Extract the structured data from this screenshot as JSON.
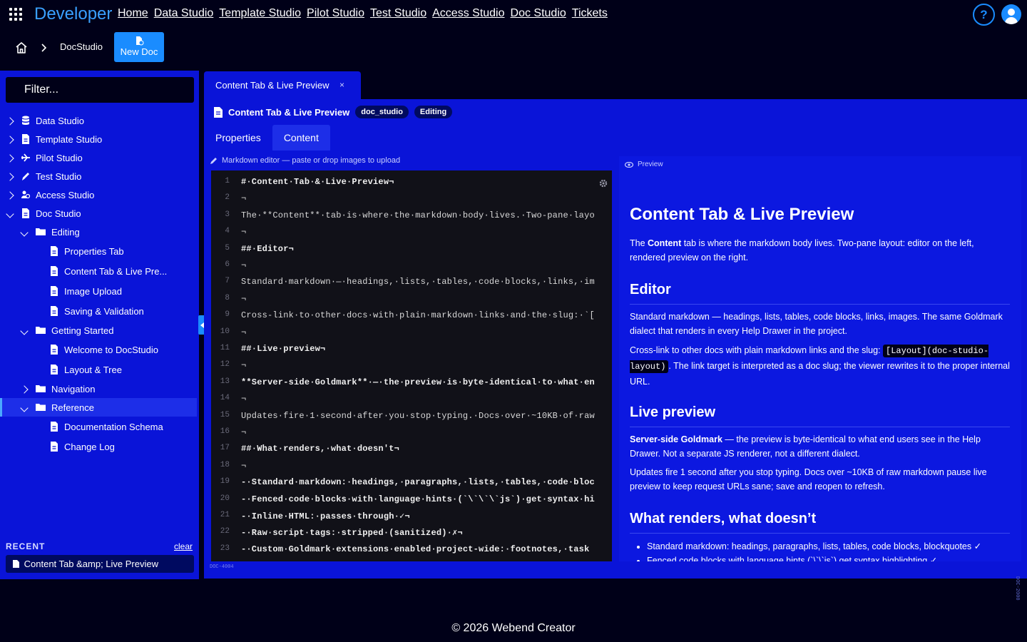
{
  "app": {
    "brand": "Developer",
    "nav": [
      "Home",
      "Data Studio",
      "Template Studio",
      "Pilot Studio",
      "Test Studio",
      "Access Studio",
      "Doc Studio",
      "Tickets"
    ],
    "help_label": "?"
  },
  "breadcrumb": {
    "current": "DocStudio",
    "new_doc_label": "New Doc"
  },
  "sidebar": {
    "filter_placeholder": "Filter...",
    "tree": [
      {
        "label": "Data Studio",
        "icon": "database-icon",
        "level": 0,
        "chevron": "right"
      },
      {
        "label": "Template Studio",
        "icon": "document-icon",
        "level": 0,
        "chevron": "right"
      },
      {
        "label": "Pilot Studio",
        "icon": "plane-icon",
        "level": 0,
        "chevron": "right"
      },
      {
        "label": "Test Studio",
        "icon": "pencil-icon",
        "level": 0,
        "chevron": "right"
      },
      {
        "label": "Access Studio",
        "icon": "users-icon",
        "level": 0,
        "chevron": "right"
      },
      {
        "label": "Doc Studio",
        "icon": "document-icon",
        "level": 0,
        "chevron": "down"
      },
      {
        "label": "Editing",
        "icon": "folder-icon",
        "level": 1,
        "chevron": "down"
      },
      {
        "label": "Properties Tab",
        "icon": "document-icon",
        "level": 2,
        "chevron": ""
      },
      {
        "label": "Content Tab & Live Pre...",
        "icon": "document-icon",
        "level": 2,
        "chevron": ""
      },
      {
        "label": "Image Upload",
        "icon": "document-icon",
        "level": 2,
        "chevron": ""
      },
      {
        "label": "Saving & Validation",
        "icon": "document-icon",
        "level": 2,
        "chevron": ""
      },
      {
        "label": "Getting Started",
        "icon": "folder-icon",
        "level": 1,
        "chevron": "down"
      },
      {
        "label": "Welcome to DocStudio",
        "icon": "document-icon",
        "level": 2,
        "chevron": ""
      },
      {
        "label": "Layout & Tree",
        "icon": "document-icon",
        "level": 2,
        "chevron": ""
      },
      {
        "label": "Navigation",
        "icon": "folder-icon",
        "level": 1,
        "chevron": "right"
      },
      {
        "label": "Reference",
        "icon": "folder-icon",
        "level": 1,
        "chevron": "down",
        "selected": true
      },
      {
        "label": "Documentation Schema",
        "icon": "document-icon",
        "level": 2,
        "chevron": ""
      },
      {
        "label": "Change Log",
        "icon": "document-icon",
        "level": 2,
        "chevron": ""
      }
    ],
    "recent_title": "RECENT",
    "recent_clear": "clear",
    "recent_item": "Content Tab &amp; Live Preview"
  },
  "doc": {
    "tab_title": "Content Tab & Live Preview",
    "close": "×",
    "title": "Content Tab & Live Preview",
    "pills": [
      "doc_studio",
      "Editing"
    ],
    "subtabs": [
      "Properties",
      "Content"
    ],
    "active_subtab": "Content",
    "editor_label": "Markdown editor — paste or drop images to upload",
    "editor_id": "DOC-4004",
    "side_id": "DOC-2000",
    "preview_label": "Preview"
  },
  "editor_lines": [
    {
      "n": "1",
      "t": "#·Content·Tab·&·Live·Preview¬",
      "h": true
    },
    {
      "n": "2",
      "t": "¬"
    },
    {
      "n": "3",
      "t": "The·**Content**·tab·is·where·the·markdown·body·lives.·Two-pane·layo"
    },
    {
      "n": "4",
      "t": "¬"
    },
    {
      "n": "5",
      "t": "##·Editor¬",
      "h": true
    },
    {
      "n": "6",
      "t": "¬"
    },
    {
      "n": "7",
      "t": "Standard·markdown·—·headings,·lists,·tables,·code·blocks,·links,·im"
    },
    {
      "n": "8",
      "t": "¬"
    },
    {
      "n": "9",
      "t": "Cross-link·to·other·docs·with·plain·markdown·links·and·the·slug:·`["
    },
    {
      "n": "10",
      "t": "¬"
    },
    {
      "n": "11",
      "t": "##·Live·preview¬",
      "h": true
    },
    {
      "n": "12",
      "t": "¬"
    },
    {
      "n": "13",
      "t": "**Server-side·Goldmark**·—·the·preview·is·byte-identical·to·what·en",
      "h": true
    },
    {
      "n": "14",
      "t": "¬"
    },
    {
      "n": "15",
      "t": "Updates·fire·1·second·after·you·stop·typing.·Docs·over·~10KB·of·raw"
    },
    {
      "n": "16",
      "t": "¬"
    },
    {
      "n": "17",
      "t": "##·What·renders,·what·doesn't¬",
      "h": true
    },
    {
      "n": "18",
      "t": "¬"
    },
    {
      "n": "19",
      "t": "-·Standard·markdown:·headings,·paragraphs,·lists,·tables,·code·bloc",
      "h": true
    },
    {
      "n": "20",
      "t": "-·Fenced·code·blocks·with·language·hints·(`\\`\\`\\`js`)·get·syntax·hi",
      "h": true
    },
    {
      "n": "21",
      "t": "-·Inline·HTML:·passes·through·✓¬",
      "h": true
    },
    {
      "n": "22",
      "t": "-·Raw·script·tags:·stripped·(sanitized)·✗¬",
      "h": true
    },
    {
      "n": "23",
      "t": "-·Custom·Goldmark·extensions·enabled·project-wide:·footnotes,·task",
      "h": true
    }
  ],
  "preview": {
    "h1": "Content Tab & Live Preview",
    "intro_pre": "The ",
    "intro_bold": "Content",
    "intro_post": " tab is where the markdown body lives. Two-pane layout: editor on the left, rendered preview on the right.",
    "h2_editor": "Editor",
    "editor_p1": "Standard markdown — headings, lists, tables, code blocks, links, images. The same Goldmark dialect that renders in every Help Drawer in the project.",
    "editor_p2_pre": "Cross-link to other docs with plain markdown links and the slug: ",
    "editor_p2_code": "[Layout](doc-studio-layout)",
    "editor_p2_post": ". The link target is interpreted as a doc slug; the viewer rewrites it to the proper internal URL.",
    "h2_live": "Live preview",
    "live_bold": "Server-side Goldmark",
    "live_p1": " — the preview is byte-identical to what end users see in the Help Drawer. Not a separate JS renderer, not a different dialect.",
    "live_p2": "Updates fire 1 second after you stop typing. Docs over ~10KB of raw markdown pause live preview to keep request URLs sane; save and reopen to refresh.",
    "h2_what": "What renders, what doesn’t",
    "li1": "Standard markdown: headings, paragraphs, lists, tables, code blocks, blockquotes ✓",
    "li2": "Fenced code blocks with language hints (`\\`\\`js`) get syntax highlighting ✓"
  },
  "footer": "© 2026 Webend Creator"
}
